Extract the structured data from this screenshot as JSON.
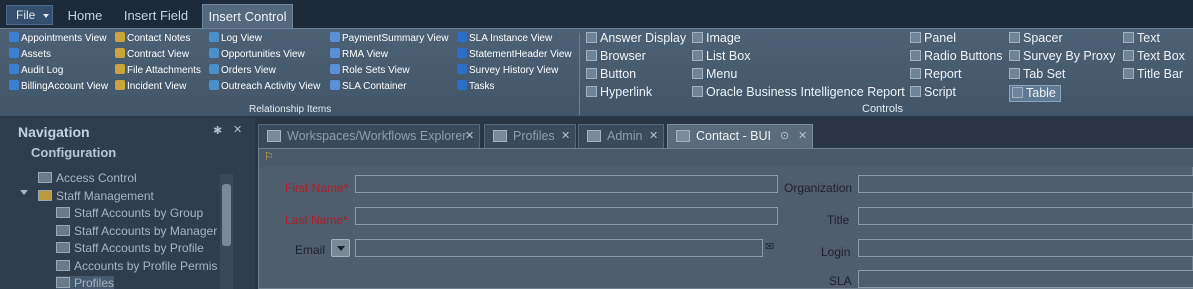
{
  "tabs": {
    "file": "File",
    "home": "Home",
    "insert_field": "Insert Field",
    "insert_control": "Insert Control"
  },
  "relationship": {
    "group_label": "Relationship Items",
    "columns": [
      [
        "Appointments View",
        "Assets",
        "Audit Log",
        "BillingAccount View"
      ],
      [
        "Contact Notes",
        "Contract View",
        "File Attachments",
        "Incident View"
      ],
      [
        "Log View",
        "Opportunities View",
        "Orders View",
        "Outreach Activity View"
      ],
      [
        "PaymentSummary View",
        "RMA View",
        "Role Sets View",
        "SLA Container"
      ],
      [
        "SLA Instance View",
        "StatementHeader View",
        "Survey History View",
        "Tasks"
      ]
    ]
  },
  "controls": {
    "group_label": "Controls",
    "columns": [
      [
        "Answer Display",
        "Browser",
        "Button",
        "Hyperlink"
      ],
      [
        "Image",
        "List Box",
        "Menu",
        "Oracle Business Intelligence Report"
      ],
      [
        "Panel",
        "Radio Buttons",
        "Report",
        "Script"
      ],
      [
        "Spacer",
        "Survey By Proxy",
        "Tab Set",
        "Table"
      ],
      [
        "Text",
        "Text Box",
        "Title Bar"
      ]
    ]
  },
  "navigation": {
    "title": "Navigation",
    "section": "Configuration",
    "items": [
      "Access Control",
      "Staff Management",
      "Staff Accounts by Group",
      "Staff Accounts by Manager",
      "Staff Accounts by Profile",
      "Accounts by Profile Permissions",
      "Profiles"
    ]
  },
  "doc_tabs": [
    "Workspaces/Workflows Explorer",
    "Profiles",
    "Admin",
    "Contact - BUI"
  ],
  "form": {
    "first_name": "First Name*",
    "last_name": "Last Name*",
    "email": "Email",
    "organization": "Organization",
    "title": "Title",
    "login": "Login",
    "sla": "SLA"
  }
}
